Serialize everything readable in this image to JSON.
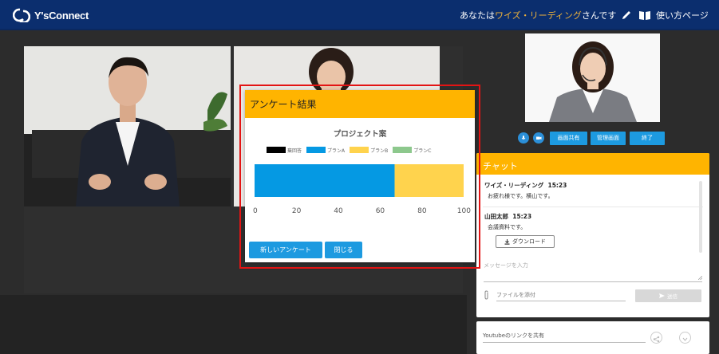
{
  "header": {
    "logo_text": "Y'sConnect",
    "user_prefix": "あなたは",
    "user_name": "ワイズ・リーディング",
    "user_suffix": "さんです",
    "guide_label": "使い方ページ"
  },
  "controls": {
    "share_screen": "画面共有",
    "admin_screen": "管理画面",
    "end": "終了"
  },
  "chat": {
    "title": "チャット",
    "messages": [
      {
        "sender": "ワイズ・リーディング",
        "time": "15:23",
        "text": "お疲れ様です。横山です。"
      },
      {
        "sender": "山田太郎",
        "time": "15:23",
        "text": "会議資料です。"
      }
    ],
    "download_label": "ダウンロード",
    "input_placeholder": "メッセージを入力",
    "attach_label": "ファイルを添付",
    "send_label": "送信"
  },
  "youtube": {
    "placeholder": "Youtubeのリンクを共有"
  },
  "survey": {
    "title": "アンケート結果",
    "new_button": "新しいアンケート",
    "close_button": "閉じる"
  },
  "chart_data": {
    "type": "bar",
    "orientation": "horizontal-stacked",
    "title": "プロジェクト案",
    "series": [
      {
        "name": "棄回答",
        "value": 0,
        "color": "#000000"
      },
      {
        "name": "プランA",
        "value": 67,
        "color": "#0599e3"
      },
      {
        "name": "プランB",
        "value": 33,
        "color": "#ffd34d"
      },
      {
        "name": "プランC",
        "value": 0,
        "color": "#8dc88d"
      }
    ],
    "xlim": [
      0,
      100
    ],
    "ticks": [
      0,
      20,
      40,
      60,
      80,
      100
    ],
    "legend": "top"
  }
}
